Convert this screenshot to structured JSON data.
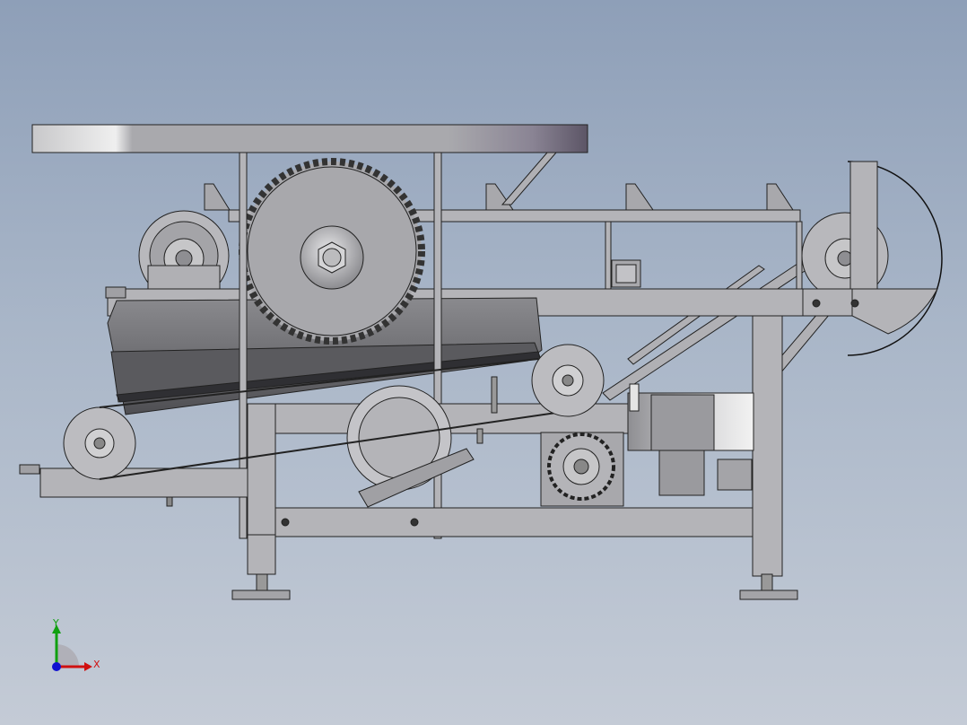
{
  "viewport": {
    "background_top": "#8e9fb8",
    "background_bottom": "#c4cbd6"
  },
  "model": {
    "name": "",
    "frame_color": "#b4b4b8",
    "panel_color": "#6e6e72",
    "edge_color": "#222222",
    "blade_color": "#a8a8ac"
  },
  "triad": {
    "x_label": "X",
    "y_label": "Y",
    "x_color": "#d01010",
    "y_color": "#10a010",
    "z_color": "#1010d0"
  }
}
